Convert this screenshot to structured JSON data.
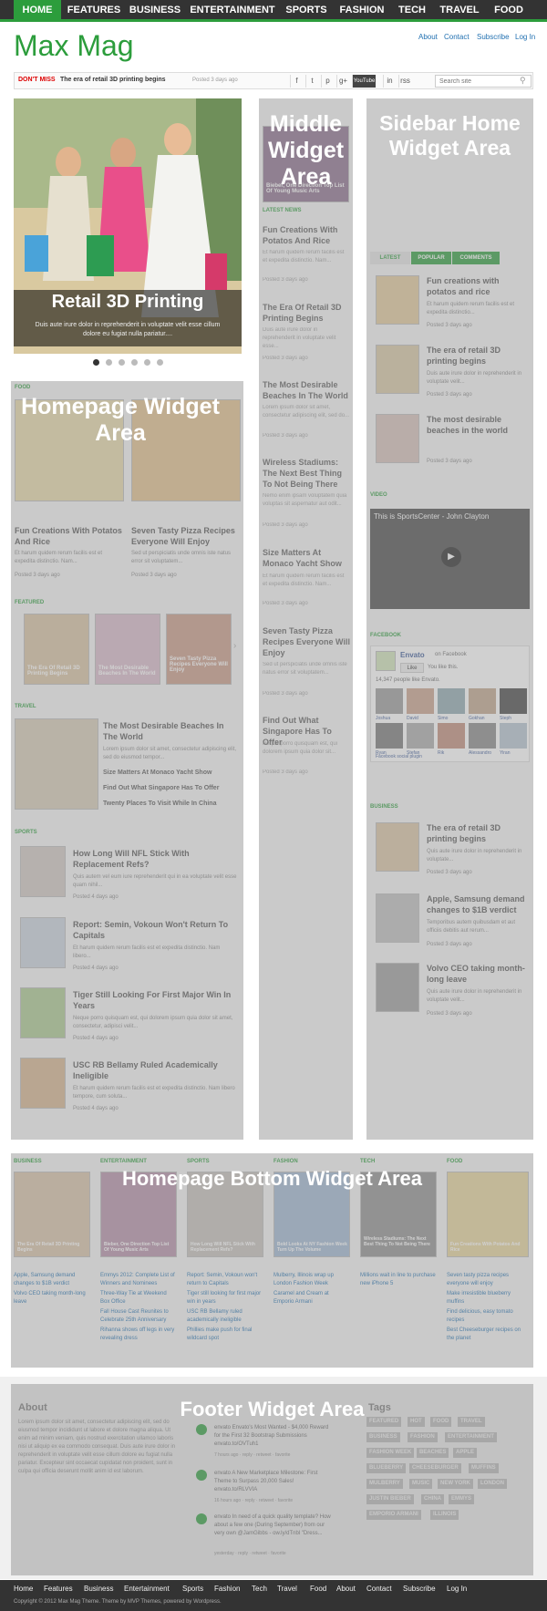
{
  "nav": {
    "items": [
      "HOME",
      "FEATURES",
      "BUSINESS",
      "ENTERTAINMENT",
      "SPORTS",
      "FASHION",
      "TECH",
      "TRAVEL",
      "FOOD"
    ]
  },
  "logo": "Max Mag",
  "toplinks": [
    "About",
    "Contact",
    "Subscribe",
    "Log In"
  ],
  "ticker": {
    "label": "DON'T MISS",
    "title": "The era of retail 3D printing begins",
    "time": "Posted 3 days ago"
  },
  "search": {
    "placeholder": "Search site"
  },
  "social": [
    "f",
    "t",
    "p",
    "g+",
    "YouTube",
    "in",
    "rss"
  ],
  "slider": {
    "title": "Retail 3D Printing",
    "text": "Duis aute irure dolor in reprehenderit in voluptate velit esse cillum dolore eu fugiat nulla pariatur....",
    "active_dot": 0
  },
  "areas": {
    "middle": "Middle Widget Area",
    "sidebar": "Sidebar Home Widget Area",
    "homepage": "Homepage Widget Area",
    "bottom": "Homepage Bottom Widget Area",
    "footer": "Footer Widget Area"
  },
  "home": {
    "food_label": "FOOD",
    "food": [
      {
        "title": "Fun Creations With Potatos And Rice",
        "text": "Et harum quidem rerum facilis est et expedita distinctio. Nam...",
        "time": "Posted 3 days ago"
      },
      {
        "title": "Seven Tasty Pizza Recipes Everyone Will Enjoy",
        "text": "Sed ut perspiciatis unde omnis iste natus error sit voluptatem...",
        "time": "Posted 3 days ago"
      }
    ],
    "featured_label": "FEATURED",
    "featured": [
      "The Era Of Retail 3D Printing Begins",
      "The Most Desirable Beaches In The World",
      "Seven Tasty Pizza Recipes Everyone Will Enjoy"
    ],
    "travel_label": "TRAVEL",
    "travel": {
      "title": "The Most Desirable Beaches In The World",
      "text": "Lorem ipsum dolor sit amet, consectetur adipiscing elit, sed do eiusmod tempor...",
      "links": [
        "Size Matters At Monaco Yacht Show",
        "Find Out What Singapore Has To Offer",
        "Twenty Places To Visit While In China"
      ]
    },
    "sports_label": "SPORTS",
    "sports": [
      {
        "title": "How Long Will NFL Stick With Replacement Refs?",
        "text": "Quis autem vel eum iure reprehenderit qui in ea voluptate velit esse quam nihil...",
        "time": "Posted 4 days ago"
      },
      {
        "title": "Report: Semin, Vokoun Won't Return To Capitals",
        "text": "Et harum quidem rerum facilis est et expedita distinctio. Nam libero...",
        "time": "Posted 4 days ago"
      },
      {
        "title": "Tiger Still Looking For First Major Win In Years",
        "text": "Neque porro quisquam est, qui dolorem ipsum quia dolor sit amet, consectetur, adipisci velit...",
        "time": "Posted 4 days ago"
      },
      {
        "title": "USC RB Bellamy Ruled Academically Ineligible",
        "text": "Et harum quidem rerum facilis est et expedita distinctio. Nam libero tempore, cum soluta...",
        "time": "Posted 4 days ago"
      }
    ]
  },
  "middle": {
    "latest_label": "LATEST NEWS",
    "img_caption": "Bieber, One Direction Top List Of Young Music Arts",
    "items": [
      {
        "title": "Fun Creations With Potatos And Rice",
        "text": "Et harum quidem rerum facilis est et expedita distinctio. Nam...",
        "time": "Posted 3 days ago"
      },
      {
        "title": "The Era Of Retail 3D Printing Begins",
        "text": "Duis aute irure dolor in reprehenderit in voluptate velit esse...",
        "time": "Posted 3 days ago"
      },
      {
        "title": "The Most Desirable Beaches In The World",
        "text": "Lorem ipsum dolor sit amet, consectetur adipiscing elit, sed do...",
        "time": "Posted 3 days ago"
      },
      {
        "title": "Wireless Stadiums: The Next Best Thing To Not Being There",
        "text": "Nemo enim ipsam voluptatem quia voluptas sit aspernatur aut odit...",
        "time": "Posted 3 days ago"
      },
      {
        "title": "Size Matters At Monaco Yacht Show",
        "text": "Et harum quidem rerum facilis est et expedita distinctio. Nam...",
        "time": "Posted 3 days ago"
      },
      {
        "title": "Seven Tasty Pizza Recipes Everyone Will Enjoy",
        "text": "Sed ut perspiciatis unde omnis iste natus error sit voluptatem...",
        "time": "Posted 3 days ago"
      },
      {
        "title": "Find Out What Singapore Has To Offer",
        "text": "Neque porro quisquam est, qui dolorem ipsum quia dolor sit...",
        "time": "Posted 3 days ago"
      }
    ]
  },
  "sidebar": {
    "tabs": [
      "LATEST",
      "POPULAR",
      "COMMENTS"
    ],
    "tab_items": [
      {
        "title": "Fun creations with potatos and rice",
        "text": "Et harum quidem rerum facilis est et expedita distinctio...",
        "time": "Posted 3 days ago"
      },
      {
        "title": "The era of retail 3D printing begins",
        "text": "Duis aute irure dolor in reprehenderit in voluptate velit...",
        "time": "Posted 3 days ago"
      },
      {
        "title": "The most desirable beaches in the world",
        "text": "",
        "time": "Posted 3 days ago"
      }
    ],
    "video_label": "VIDEO",
    "video_title": "This is SportsCenter - John Clayton",
    "facebook_label": "FACEBOOK",
    "fb_name": "Envato",
    "fb_on": "on Facebook",
    "fb_like": "Like",
    "fb_you": "You like this.",
    "fb_count": "14,347 people like Envato.",
    "fb_names": [
      "Joshua",
      "David",
      "Simo",
      "Gokhan",
      "Steph",
      "Ryan",
      "Stefan",
      "Rik",
      "Alessandro",
      "Yiran"
    ],
    "fb_plugin": "Facebook social plugin",
    "business_label": "BUSINESS",
    "business": [
      {
        "title": "The era of retail 3D printing begins",
        "text": "Quis aute irure dolor in reprehenderit in voluptate...",
        "time": "Posted 3 days ago"
      },
      {
        "title": "Apple, Samsung demand changes to $1B verdict",
        "text": "Temporibus autem quibusdam et aut officiis debitis aut rerum...",
        "time": "Posted 3 days ago"
      },
      {
        "title": "Volvo CEO taking month-long leave",
        "text": "Quis aute irure dolor in reprehenderit in voluptate velit...",
        "time": "Posted 3 days ago"
      }
    ]
  },
  "bottom": {
    "cols": [
      {
        "label": "BUSINESS",
        "img": "The Era Of Retail 3D Printing Begins",
        "links": [
          "Apple, Samsung demand changes to $1B verdict",
          "Volvo CEO taking month-long leave"
        ]
      },
      {
        "label": "ENTERTAINMENT",
        "img": "Bieber, One Direction Top List Of Young Music Arts",
        "links": [
          "Emmys 2012: Complete List of Winners and Nominees",
          "Three-Way Tie at Weekend Box Office",
          "Fall House Cast Reunites to Celebrate 25th Anniversary",
          "Rihanna shows off legs in very revealing dress"
        ]
      },
      {
        "label": "SPORTS",
        "img": "How Long Will NFL Stick With Replacement Refs?",
        "links": [
          "Report: Semin, Vokoun won't return to Capitals",
          "Tiger still looking for first major win in years",
          "USC RB Bellamy ruled academically ineligible",
          "Phillies make push for final wildcard spot"
        ]
      },
      {
        "label": "FASHION",
        "img": "Bold Looks At NY Fashion Week Turn Up The Volume",
        "links": [
          "Mulberry, Illinois wrap up London Fashion Week",
          "Caramel and Cream at Emporio Armani"
        ]
      },
      {
        "label": "TECH",
        "img": "Wireless Stadiums: The Next Best Thing To Not Being There",
        "links": [
          "Millions wait in line to purchase new iPhone 5"
        ]
      },
      {
        "label": "FOOD",
        "img": "Fun Creations With Potatos And Rice",
        "links": [
          "Seven tasty pizza recipes everyone will enjoy",
          "Make irresistible blueberry muffins",
          "Find delicious, easy tomato recipes",
          "Best Cheeseburger recipes on the planet"
        ]
      }
    ]
  },
  "footer": {
    "about_label": "About",
    "about_text": "Lorem ipsum dolor sit amet, consectetur adipiscing elit, sed do eiusmod tempor incididunt ut labore et dolore magna aliqua. Ut enim ad minim veniam, quis nostrud exercitation ullamco laboris nisi ut aliquip ex ea commodo consequat. Duis aute irure dolor in reprehenderit in voluptate velit esse cillum dolore eu fugiat nulla pariatur. Excepteur sint occaecat cupidatat non proident, sunt in culpa qui officia deserunt mollit anim id est laborum.",
    "tweets": [
      {
        "text": "envato Envato's Most Wanted - $4,000 Reward for the First 32 Bootstrap Submissions envato.to/OVTuh1",
        "meta": "7 hours ago · reply · retweet · favorite"
      },
      {
        "text": "envato A New Marketplace Milestone: First Theme to Surpass 20,000 Sales! envato.to/RLVVIA",
        "meta": "16 hours ago · reply · retweet · favorite"
      },
      {
        "text": "envato In need of a quick quality template? How about a few one (During September) from our very own @JamGibbs - ow.ly/dTnbl \"Dress...",
        "meta": "yesterday · reply · retweet · favorite"
      }
    ],
    "tags_label": "Tags",
    "tags": [
      "FEATURED",
      "HOT",
      "FOOD",
      "TRAVEL",
      "BUSINESS",
      "FASHION",
      "ENTERTAINMENT",
      "FASHION WEEK",
      "BEACHES",
      "APPLE",
      "BLUEBERRY",
      "CHEESEBURGER",
      "MUFFINS",
      "MULBERRY",
      "MUSIC",
      "NEW YORK",
      "LONDON",
      "JUSTIN BIEBER",
      "CHINA",
      "EMMYS",
      "EMPORIO ARMANI",
      "ILLINOIS"
    ]
  },
  "bottomnav": {
    "links": [
      "Home",
      "Features",
      "Business",
      "Entertainment",
      "Sports",
      "Fashion",
      "Tech",
      "Travel",
      "Food",
      "About",
      "Contact",
      "Subscribe",
      "Log In"
    ],
    "copyright": "Copyright © 2012 Max Mag Theme. Theme by MVP Themes, powered by Wordpress."
  },
  "colors": {
    "accent": "#2c9d3c",
    "nav_bg": "#333333",
    "overlay": "#969696",
    "link": "#2271b1"
  }
}
